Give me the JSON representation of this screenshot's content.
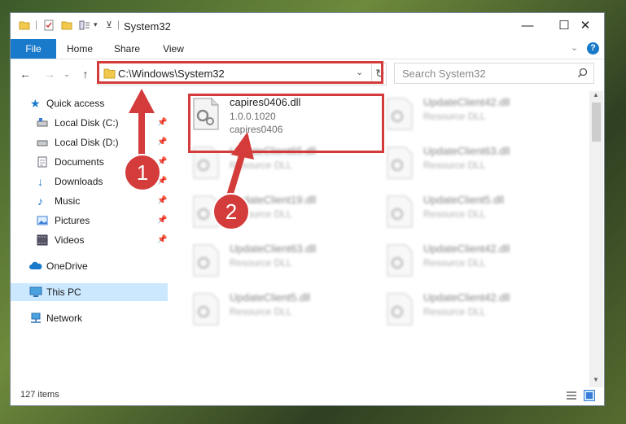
{
  "window": {
    "title": "System32",
    "minimize": "—",
    "maximize": "☐",
    "close": "✕"
  },
  "ribbon": {
    "tabs": [
      "File",
      "Home",
      "Share",
      "View"
    ],
    "help": "?"
  },
  "address": {
    "path": "C:\\Windows\\System32",
    "search_placeholder": "Search System32"
  },
  "nav": {
    "items": [
      {
        "label": "Quick access",
        "icon": "star-icon",
        "pinned": false
      },
      {
        "label": "Local Disk (C:)",
        "icon": "drive-icon",
        "pinned": true
      },
      {
        "label": "Local Disk (D:)",
        "icon": "drive-icon",
        "pinned": true
      },
      {
        "label": "Documents",
        "icon": "documents-icon",
        "pinned": true
      },
      {
        "label": "Downloads",
        "icon": "download-icon",
        "pinned": true
      },
      {
        "label": "Music",
        "icon": "music-icon",
        "pinned": true
      },
      {
        "label": "Pictures",
        "icon": "pictures-icon",
        "pinned": true
      },
      {
        "label": "Videos",
        "icon": "videos-icon",
        "pinned": true
      },
      {
        "label": "OneDrive",
        "icon": "cloud-icon",
        "pinned": false
      },
      {
        "label": "This PC",
        "icon": "computer-icon",
        "pinned": false,
        "selected": true
      },
      {
        "label": "Network",
        "icon": "network-icon",
        "pinned": false
      }
    ]
  },
  "files": [
    {
      "name": "capires0406.dll",
      "line2": "1.0.0.1020",
      "line3": "capires0406",
      "blurred": false
    },
    {
      "name": "UpdateClient42.dll",
      "line2": "Resource DLL",
      "blurred": true
    },
    {
      "name": "UpdateClient65.dll",
      "line2": "Resource DLL",
      "blurred": true
    },
    {
      "name": "UpdateClient63.dll",
      "line2": "Resource DLL",
      "blurred": true
    },
    {
      "name": "UpdateClient19.dll",
      "line2": "Resource DLL",
      "blurred": true
    },
    {
      "name": "UpdateClient5.dll",
      "line2": "Resource DLL",
      "blurred": true
    },
    {
      "name": "UpdateClient63.dll",
      "line2": "Resource DLL",
      "blurred": true
    },
    {
      "name": "UpdateClient42.dll",
      "line2": "Resource DLL",
      "blurred": true
    },
    {
      "name": "UpdateClient5.dll",
      "line2": "Resource DLL",
      "blurred": true
    },
    {
      "name": "UpdateClient42.dll",
      "line2": "Resource DLL",
      "blurred": true
    }
  ],
  "status": {
    "item_count": "127 items"
  },
  "annotations": {
    "step1": "1",
    "step2": "2",
    "color": "#d43b3b"
  }
}
